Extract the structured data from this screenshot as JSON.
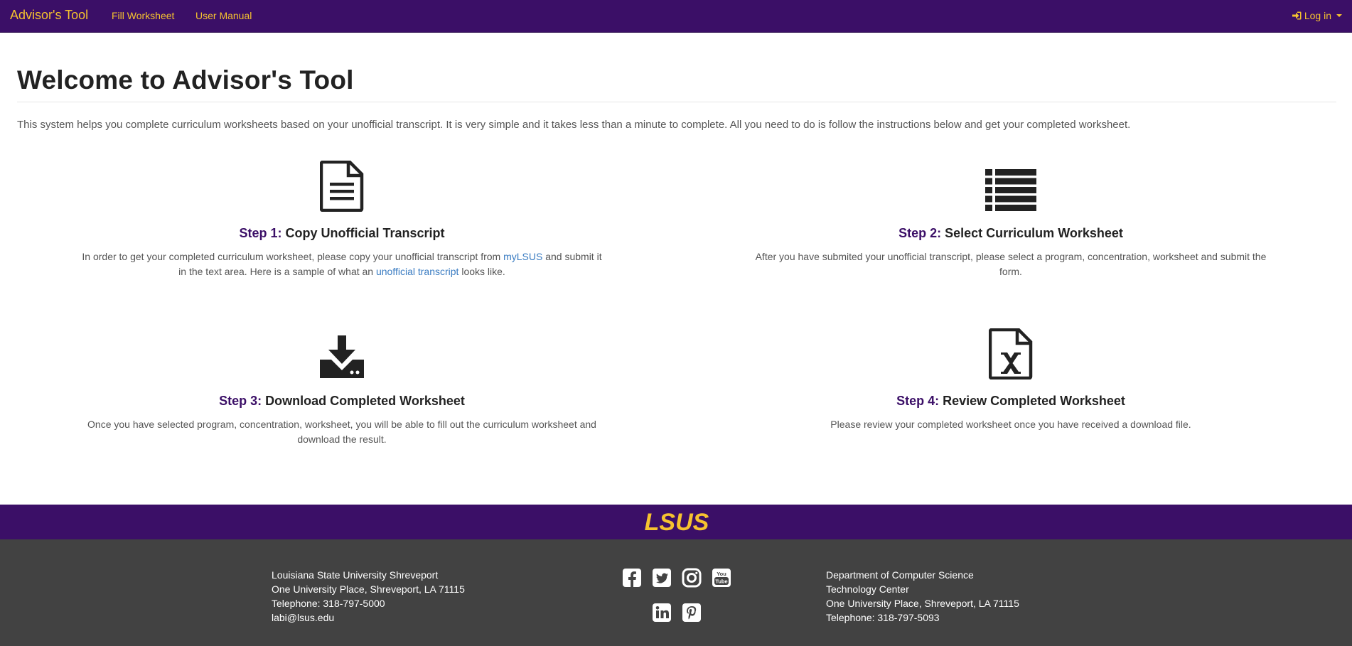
{
  "navbar": {
    "brand": "Advisor's Tool",
    "links": [
      "Fill Worksheet",
      "User Manual"
    ],
    "login": "Log in"
  },
  "page": {
    "title": "Welcome to Advisor's Tool",
    "intro": "This system helps you complete curriculum worksheets based on your unofficial transcript. It is very simple and it takes less than a minute to complete. All you need to do is follow the instructions below and get your completed worksheet."
  },
  "steps": [
    {
      "number": "Step 1:",
      "title": "Copy Unofficial Transcript",
      "icon": "file-text-icon",
      "desc_a": "In order to get your completed curriculum worksheet, please copy your unofficial transcript from ",
      "link1": "myLSUS",
      "desc_b": " and submit it in the text area. Here is a sample of what an ",
      "link2": "unofficial transcript",
      "desc_c": " looks like."
    },
    {
      "number": "Step 2:",
      "title": "Select Curriculum Worksheet",
      "icon": "list-icon",
      "desc": "After you have submited your unofficial transcript, please select a program, concentration, worksheet and submit the form."
    },
    {
      "number": "Step 3:",
      "title": "Download Completed Worksheet",
      "icon": "download-icon",
      "desc": "Once you have selected program, concentration, worksheet, you will be able to fill out the curriculum worksheet and download the result."
    },
    {
      "number": "Step 4:",
      "title": "Review Completed Worksheet",
      "icon": "excel-file-icon",
      "desc": "Please review your completed worksheet once you have received a download file."
    }
  ],
  "footer": {
    "logo_text": "LSUS",
    "left": [
      "Louisiana State University Shreveport",
      "One University Place, Shreveport, LA 71115",
      "Telephone: 318-797-5000",
      "labi@lsus.edu"
    ],
    "right": [
      "Department of Computer Science",
      "Technology Center",
      "One University Place, Shreveport, LA 71115",
      "Telephone: 318-797-5093"
    ],
    "social_icons": [
      "facebook-icon",
      "twitter-icon",
      "instagram-icon",
      "youtube-icon",
      "linkedin-icon",
      "pinterest-icon"
    ]
  },
  "colors": {
    "navbar": "#3b0f67",
    "accent": "#f6c32f",
    "link": "#3a7cc2",
    "footer": "#424242"
  }
}
